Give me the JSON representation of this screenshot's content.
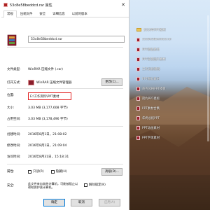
{
  "dialog": {
    "title": "53c8e58beddcd.rar 属性",
    "close_glyph": "✕",
    "tabs": [
      {
        "label": "常规",
        "active": true
      },
      {
        "label": "压缩文件"
      },
      {
        "label": "安全"
      },
      {
        "label": "详细信息"
      },
      {
        "label": "以前的版本"
      }
    ],
    "file_name": "53c8e58beddcd.rar",
    "fields": {
      "file_type_label": "文件类型:",
      "file_type_value": "WinRAR 压缩文件 (.rar)",
      "open_with_label": "打开方式:",
      "open_with_value": "WinRAR 压缩文件管理器",
      "change_button": "更改(C)...",
      "location_label": "位置:",
      "location_value": "E:\\工作资料\\PPT素材",
      "size_label": "大小:",
      "size_value": "3.03 MB (3,177,608 字节)",
      "size_on_disk_label": "占用空间:",
      "size_on_disk_value": "3.03 MB (3,178,496 字节)",
      "created_label": "创建时间:",
      "created_value": "2016年8月1日，21:08:02",
      "modified_label": "修改时间:",
      "modified_value": "2016年8月1日，21:09:04",
      "accessed_label": "访问时间:",
      "accessed_value": "2016年8月31日，15:18:31",
      "attributes_label": "属性:",
      "readonly_label": "只读(R)",
      "hidden_label": "隐藏(H)",
      "advanced_button": "高级(D)...",
      "security_label": "安全:",
      "security_text": "此文件来自其他计算机，可能被阻止以帮助保护该计算机。",
      "unblock_label": "解除锁定(K)"
    },
    "buttons": {
      "ok": "确定",
      "cancel": "取消",
      "apply": "应用(A)"
    }
  },
  "desktop": {
    "files": [
      {
        "name": "2016年PPT素材",
        "type": "folder"
      },
      {
        "name": "53c8e58beddcd.rar",
        "type": "rar"
      },
      {
        "name": "PPT模板素材",
        "type": "rar"
      },
      {
        "name": "PPT背景图片素材",
        "type": "rar"
      },
      {
        "name": "工作总结模板",
        "type": "rar"
      },
      {
        "name": "PPT图标素材",
        "type": "rar"
      },
      {
        "name": "商务风格PPT模板",
        "type": "rar"
      },
      {
        "name": "简约PPT模板",
        "type": "rar"
      },
      {
        "name": "PPT素材合集",
        "type": "rar"
      },
      {
        "name": "年终总结PPT",
        "type": "rar"
      },
      {
        "name": "PPT动画素材",
        "type": "rar"
      },
      {
        "name": "PPT字体素材",
        "type": "rar"
      }
    ]
  }
}
